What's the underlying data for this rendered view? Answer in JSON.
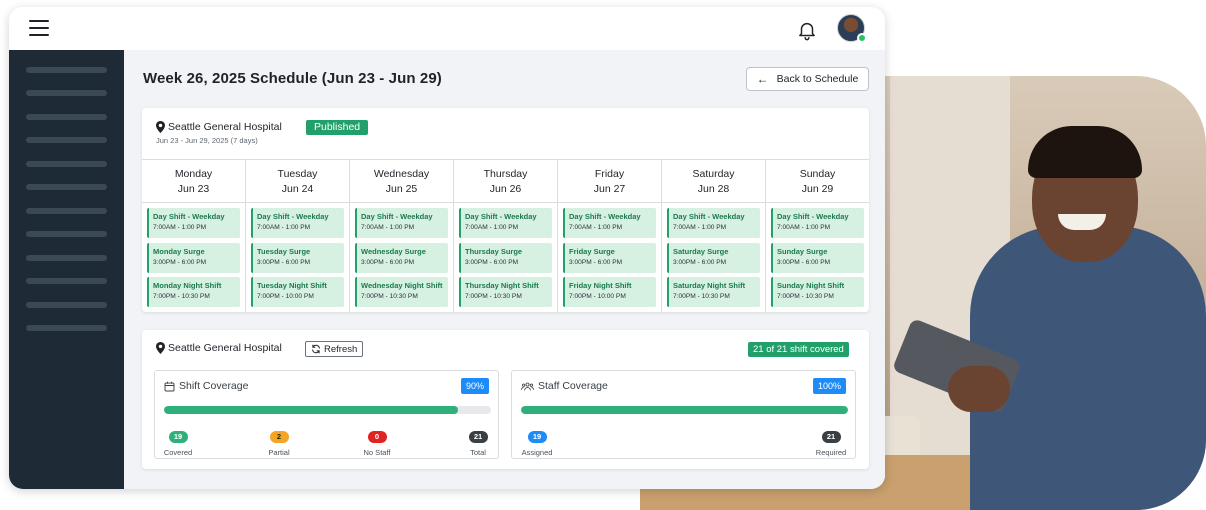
{
  "header": {
    "menu_icon": "hamburger-icon",
    "bell_icon": "bell-icon",
    "avatar": "user-avatar"
  },
  "page": {
    "title": "Week 26, 2025 Schedule (Jun 23 - Jun 29)",
    "back_label": "Back to Schedule"
  },
  "schedule": {
    "location": "Seattle General Hospital",
    "status": "Published",
    "date_range": "Jun 23 - Jun 29, 2025 (7 days)",
    "days": [
      {
        "name": "Monday",
        "date": "Jun 23",
        "shifts": [
          {
            "name": "Day Shift - Weekday",
            "time": "7:00AM - 1:00 PM"
          },
          {
            "name": "Monday Surge",
            "time": "3:00PM - 6:00 PM"
          },
          {
            "name": "Monday Night Shift",
            "time": "7:00PM - 10:30 PM"
          }
        ]
      },
      {
        "name": "Tuesday",
        "date": "Jun 24",
        "shifts": [
          {
            "name": "Day Shift - Weekday",
            "time": "7:00AM - 1:00 PM"
          },
          {
            "name": "Tuesday Surge",
            "time": "3:00PM - 6:00 PM"
          },
          {
            "name": "Tuesday Night Shift",
            "time": "7:00PM - 10:00 PM"
          }
        ]
      },
      {
        "name": "Wednesday",
        "date": "Jun 25",
        "shifts": [
          {
            "name": "Day Shift - Weekday",
            "time": "7:00AM - 1:00 PM"
          },
          {
            "name": "Wednesday Surge",
            "time": "3:00PM - 6:00 PM"
          },
          {
            "name": "Wednesday Night Shift",
            "time": "7:00PM - 10:30 PM"
          }
        ]
      },
      {
        "name": "Thursday",
        "date": "Jun 26",
        "shifts": [
          {
            "name": "Day Shift - Weekday",
            "time": "7:00AM - 1:00 PM"
          },
          {
            "name": "Thursday Surge",
            "time": "3:00PM - 6:00 PM"
          },
          {
            "name": "Thursday Night Shift",
            "time": "7:00PM - 10:30 PM"
          }
        ]
      },
      {
        "name": "Friday",
        "date": "Jun 27",
        "shifts": [
          {
            "name": "Day Shift - Weekday",
            "time": "7:00AM - 1:00 PM"
          },
          {
            "name": "Friday Surge",
            "time": "3:00PM - 6:00 PM"
          },
          {
            "name": "Friday Night Shift",
            "time": "7:00PM - 10:00 PM"
          }
        ]
      },
      {
        "name": "Saturday",
        "date": "Jun 28",
        "shifts": [
          {
            "name": "Day Shift - Weekday",
            "time": "7:00AM - 1:00 PM"
          },
          {
            "name": "Saturday Surge",
            "time": "3:00PM - 6:00 PM"
          },
          {
            "name": "Saturday Night Shift",
            "time": "7:00PM - 10:30 PM"
          }
        ]
      },
      {
        "name": "Sunday",
        "date": "Jun 29",
        "shifts": [
          {
            "name": "Day Shift - Weekday",
            "time": "7:00AM - 1:00 PM"
          },
          {
            "name": "Sunday Surge",
            "time": "3:00PM - 6:00 PM"
          },
          {
            "name": "Sunday Night Shift",
            "time": "7:00PM - 10:30 PM"
          }
        ]
      }
    ]
  },
  "coverage": {
    "location": "Seattle General Hospital",
    "refresh_label": "Refresh",
    "summary": "21 of 21 shift covered",
    "shift": {
      "title": "Shift Coverage",
      "percent_label": "90%",
      "progress": 0.9,
      "stats": [
        {
          "value": "19",
          "label": "Covered",
          "color": "#2fb07a"
        },
        {
          "value": "2",
          "label": "Partial",
          "color": "#f4a522"
        },
        {
          "value": "0",
          "label": "No Staff",
          "color": "#e02424"
        },
        {
          "value": "21",
          "label": "Total",
          "color": "#3a3f44"
        }
      ]
    },
    "staff": {
      "title": "Staff Coverage",
      "percent_label": "100%",
      "progress": 1.0,
      "stats": [
        {
          "value": "19",
          "label": "Assigned",
          "color": "#1d8cf8"
        },
        {
          "value": "21",
          "label": "Required",
          "color": "#3a3f44"
        }
      ]
    }
  },
  "colors": {
    "accent_green": "#22a06b",
    "accent_blue": "#1d8cf8",
    "sidebar": "#1e2a36"
  }
}
